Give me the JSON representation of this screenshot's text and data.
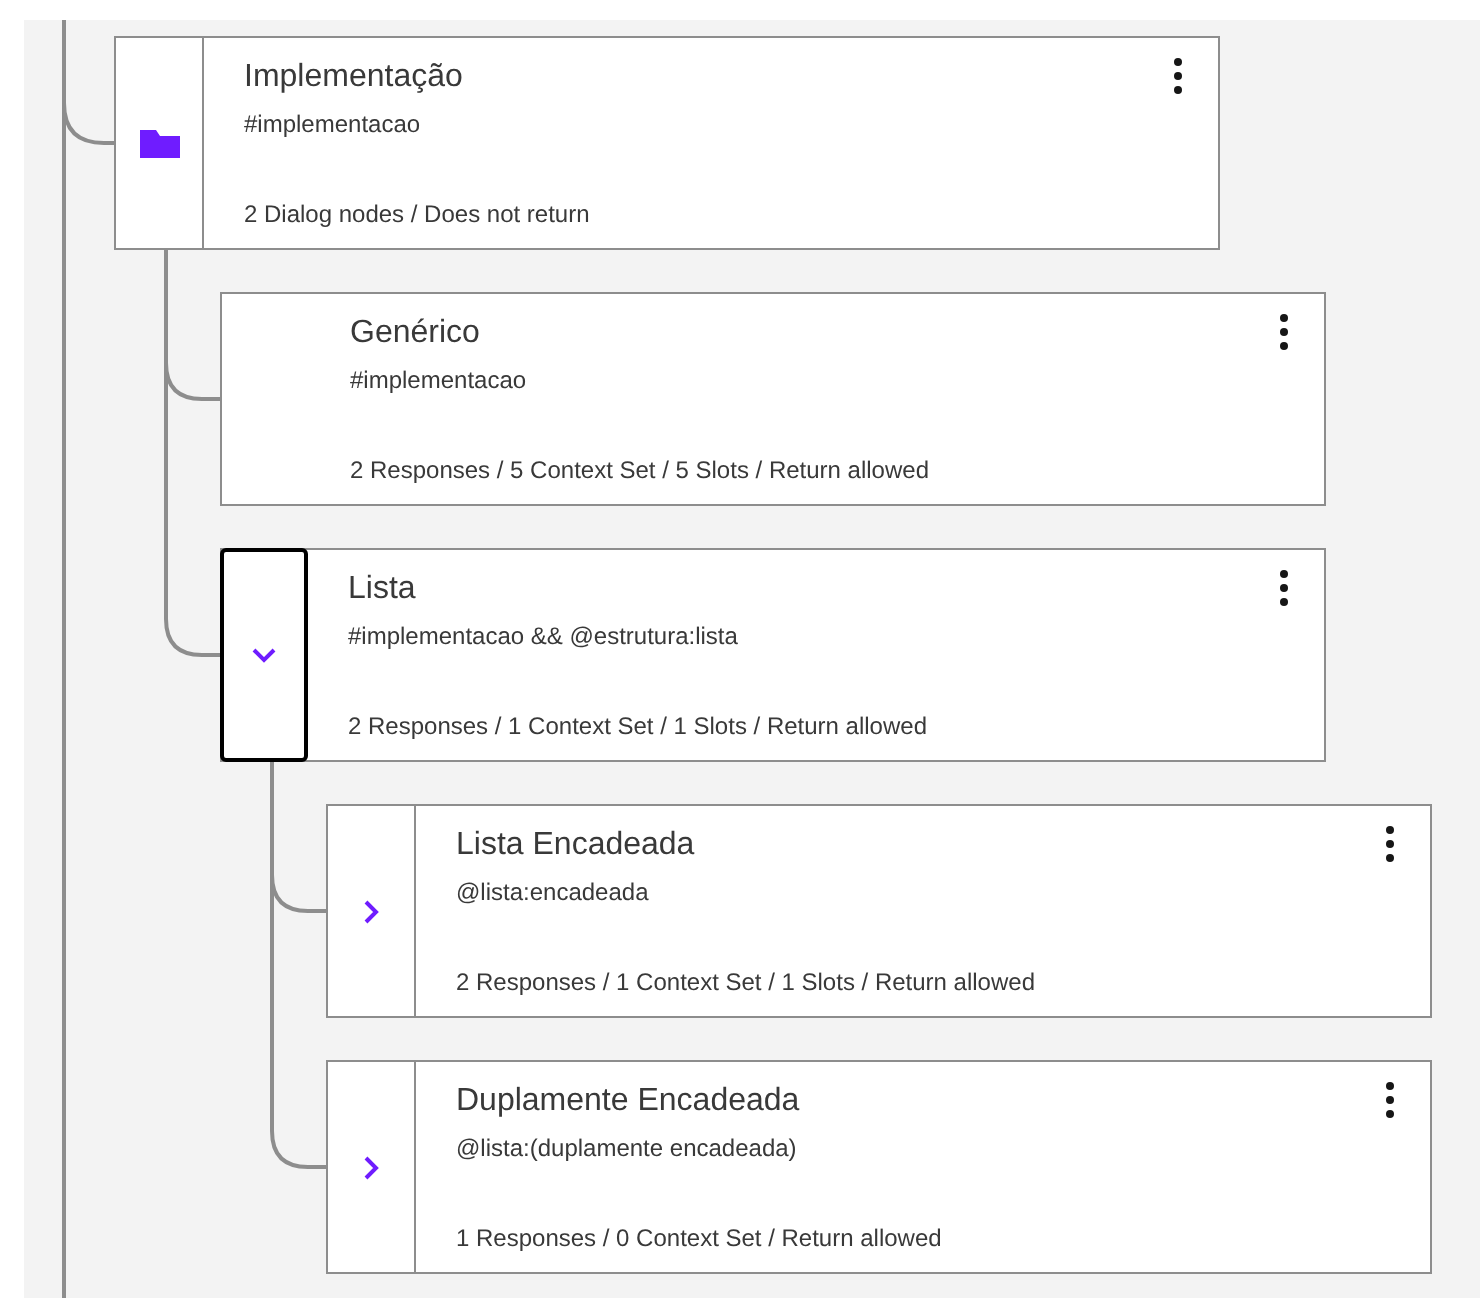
{
  "nodes": [
    {
      "title": "Implementação",
      "condition": "#implementacao",
      "summary": "2 Dialog nodes / Does not return",
      "kind": "folder",
      "focused": false,
      "children": [
        {
          "title": "Genérico",
          "condition": "#implementacao",
          "summary": "2 Responses / 5 Context Set / 5 Slots / Return allowed",
          "kind": "plain",
          "focused": false
        },
        {
          "title": "Lista",
          "condition": "#implementacao && @estrutura:lista",
          "summary": "2 Responses / 1 Context Set / 1 Slots / Return allowed",
          "kind": "toggle",
          "expanded": true,
          "focused": true,
          "children": [
            {
              "title": "Lista Encadeada",
              "condition": "@lista:encadeada",
              "summary": "2 Responses / 1 Context Set / 1 Slots / Return allowed",
              "kind": "toggle",
              "expanded": false,
              "focused": false
            },
            {
              "title": "Duplamente Encadeada",
              "condition": "@lista:(duplamente encadeada)",
              "summary": "1 Responses / 0 Context Set / Return allowed",
              "kind": "toggle",
              "expanded": false,
              "focused": false
            }
          ]
        }
      ]
    }
  ]
}
